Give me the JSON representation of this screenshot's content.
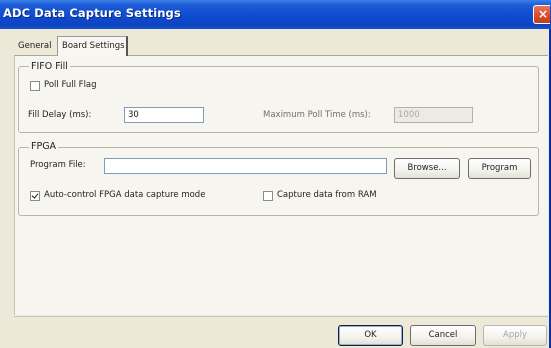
{
  "window": {
    "title": "ADC Data Capture Settings",
    "close_glyph": "×"
  },
  "tabs": [
    {
      "label": "General",
      "active": false
    },
    {
      "label": "Board Settings",
      "active": true
    }
  ],
  "fifo_group": {
    "legend": "FIFO Fill",
    "poll_full_flag": {
      "label": "Poll Full Flag",
      "checked": false
    },
    "fill_delay": {
      "label": "Fill Delay (ms):",
      "value": "30"
    },
    "max_poll_time": {
      "label": "Maximum Poll Time (ms):",
      "value": "1000",
      "enabled": false
    }
  },
  "fpga_group": {
    "legend": "FPGA",
    "program_file": {
      "label": "Program File:",
      "value": ""
    },
    "browse_label": "Browse...",
    "program_label": "Program",
    "auto_control": {
      "label": "Auto-control FPGA data capture mode",
      "checked": true
    },
    "capture_ram": {
      "label": "Capture data from RAM",
      "checked": false
    }
  },
  "footer": {
    "ok_label": "OK",
    "cancel_label": "Cancel",
    "apply_label": "Apply"
  },
  "colors": {
    "titlebar": "#0f4bd0",
    "dialog_bg": "#ece9d8",
    "close_button": "#d64a2a"
  }
}
